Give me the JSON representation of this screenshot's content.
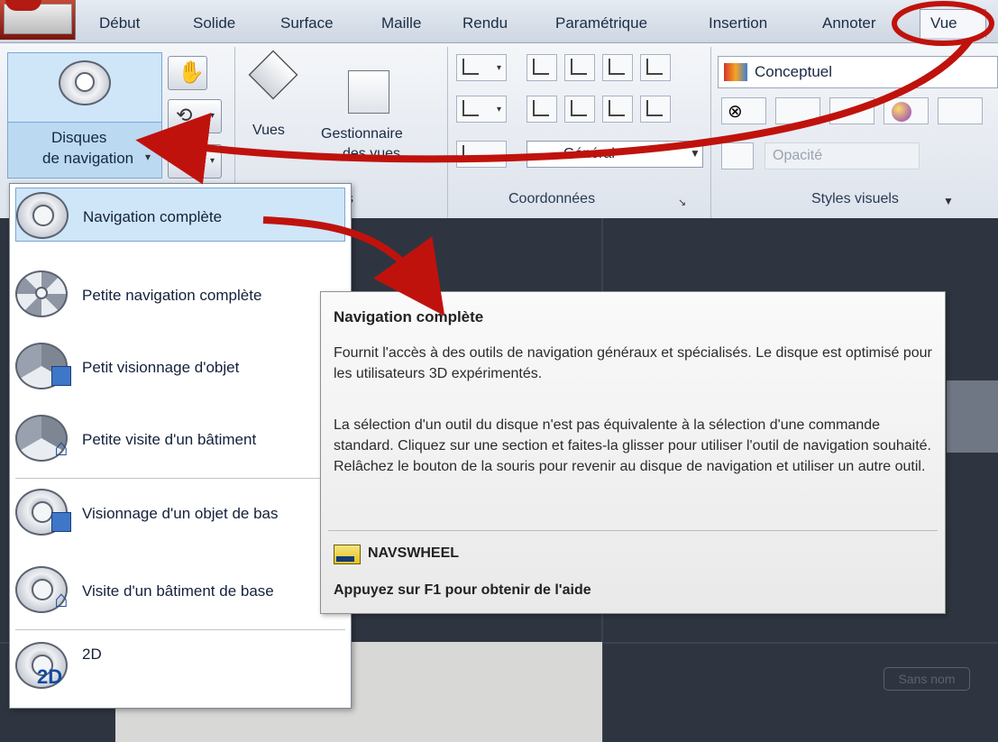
{
  "tabs": [
    "Début",
    "Solide",
    "Surface",
    "Maille",
    "Rendu",
    "Paramétrique",
    "Insertion",
    "Annoter",
    "Vue"
  ],
  "ribbon": {
    "nav_button_label_line1": "Disques",
    "nav_button_label_line2": "de navigation",
    "vues_label": "Vues",
    "gestionnaire_label_line1": "Gestionnaire",
    "gestionnaire_label_line2": "des vues",
    "panel_navigate_title_fragment": "s",
    "panel_coords_title": "Coordonnées",
    "panel_visual_title": "Styles visuels",
    "visual_style_value": "Conceptuel",
    "ucs_combo_value": "Général",
    "opacity_placeholder": "Opacité"
  },
  "menu": {
    "items": [
      {
        "label": "Navigation complète",
        "icon": "full-navigation-wheel-icon"
      },
      {
        "label": "Petite navigation complète",
        "icon": "mini-full-navigation-wheel-icon"
      },
      {
        "label": "Petit visionnage d'objet",
        "icon": "mini-view-object-wheel-icon"
      },
      {
        "label": "Petite visite d'un bâtiment",
        "icon": "mini-tour-building-wheel-icon"
      },
      {
        "label": "Visionnage d'un objet de bas",
        "icon": "view-object-wheel-icon"
      },
      {
        "label": "Visite d'un bâtiment de base",
        "icon": "tour-building-wheel-icon"
      },
      {
        "label": "2D",
        "icon": "2d-wheel-icon",
        "badge": "2D"
      }
    ]
  },
  "tooltip": {
    "title": "Navigation complète",
    "para1": "Fournit l'accès à des outils de navigation généraux et spécialisés. Le disque est optimisé pour les utilisateurs 3D expérimentés.",
    "para2": "La sélection d'un outil du disque n'est pas équivalente à la sélection d'une commande standard. Cliquez sur une section et faites-la glisser pour utiliser l'outil de navigation souhaité. Relâchez le bouton de la souris pour revenir au disque de navigation et utiliser un autre outil.",
    "command": "NAVSWHEEL",
    "help": "Appuyez sur F1 pour obtenir de l'aide"
  },
  "canvas": {
    "viewport_label": "Sans nom"
  },
  "colors": {
    "arrow_red": "#c0120d",
    "canvas_dark": "#2f3540",
    "highlight_blue": "#cfe6f8"
  }
}
